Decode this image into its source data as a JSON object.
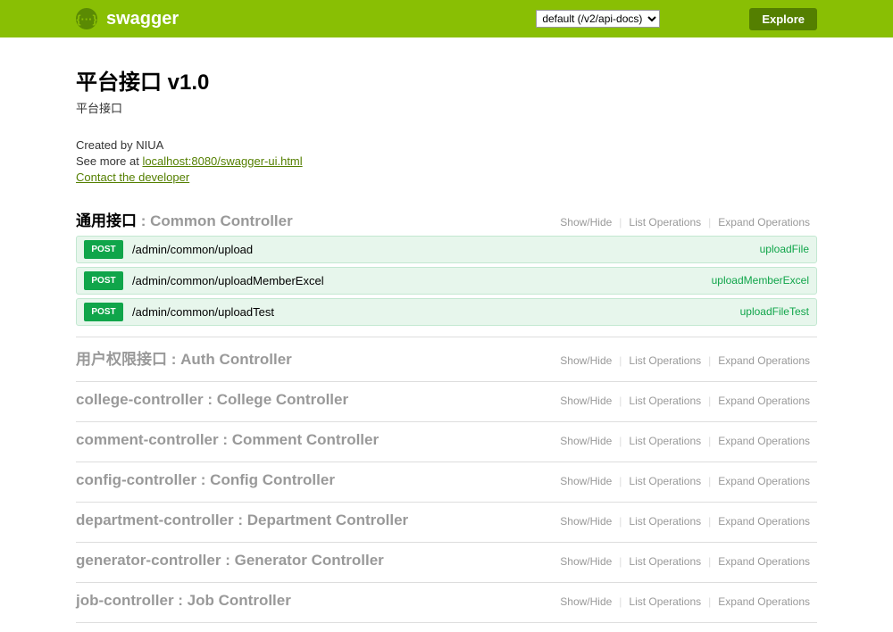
{
  "header": {
    "logo_braces": "{···}",
    "logo_text": "swagger",
    "select_value": "default (/v2/api-docs)",
    "explore_label": "Explore"
  },
  "api": {
    "title": "平台接口 v1.0",
    "subtitle": "平台接口",
    "created_by_prefix": "Created by ",
    "created_by": "NIUA",
    "see_more_prefix": "See more at ",
    "see_more_link": "localhost:8080/swagger-ui.html",
    "contact_link": "Contact the developer"
  },
  "actions": {
    "show_hide": "Show/Hide",
    "list_ops": "List Operations",
    "expand_ops": "Expand Operations"
  },
  "resources": [
    {
      "name": "通用接口",
      "label": "Common Controller",
      "expanded": true,
      "operations": [
        {
          "method": "POST",
          "path": "/admin/common/upload",
          "summary": "uploadFile"
        },
        {
          "method": "POST",
          "path": "/admin/common/uploadMemberExcel",
          "summary": "uploadMemberExcel"
        },
        {
          "method": "POST",
          "path": "/admin/common/uploadTest",
          "summary": "uploadFileTest"
        }
      ]
    },
    {
      "name": "用户权限接口",
      "label": "Auth Controller",
      "expanded": false
    },
    {
      "name": "college-controller",
      "label": "College Controller",
      "expanded": false
    },
    {
      "name": "comment-controller",
      "label": "Comment Controller",
      "expanded": false
    },
    {
      "name": "config-controller",
      "label": "Config Controller",
      "expanded": false
    },
    {
      "name": "department-controller",
      "label": "Department Controller",
      "expanded": false
    },
    {
      "name": "generator-controller",
      "label": "Generator Controller",
      "expanded": false
    },
    {
      "name": "job-controller",
      "label": "Job Controller",
      "expanded": false
    }
  ]
}
